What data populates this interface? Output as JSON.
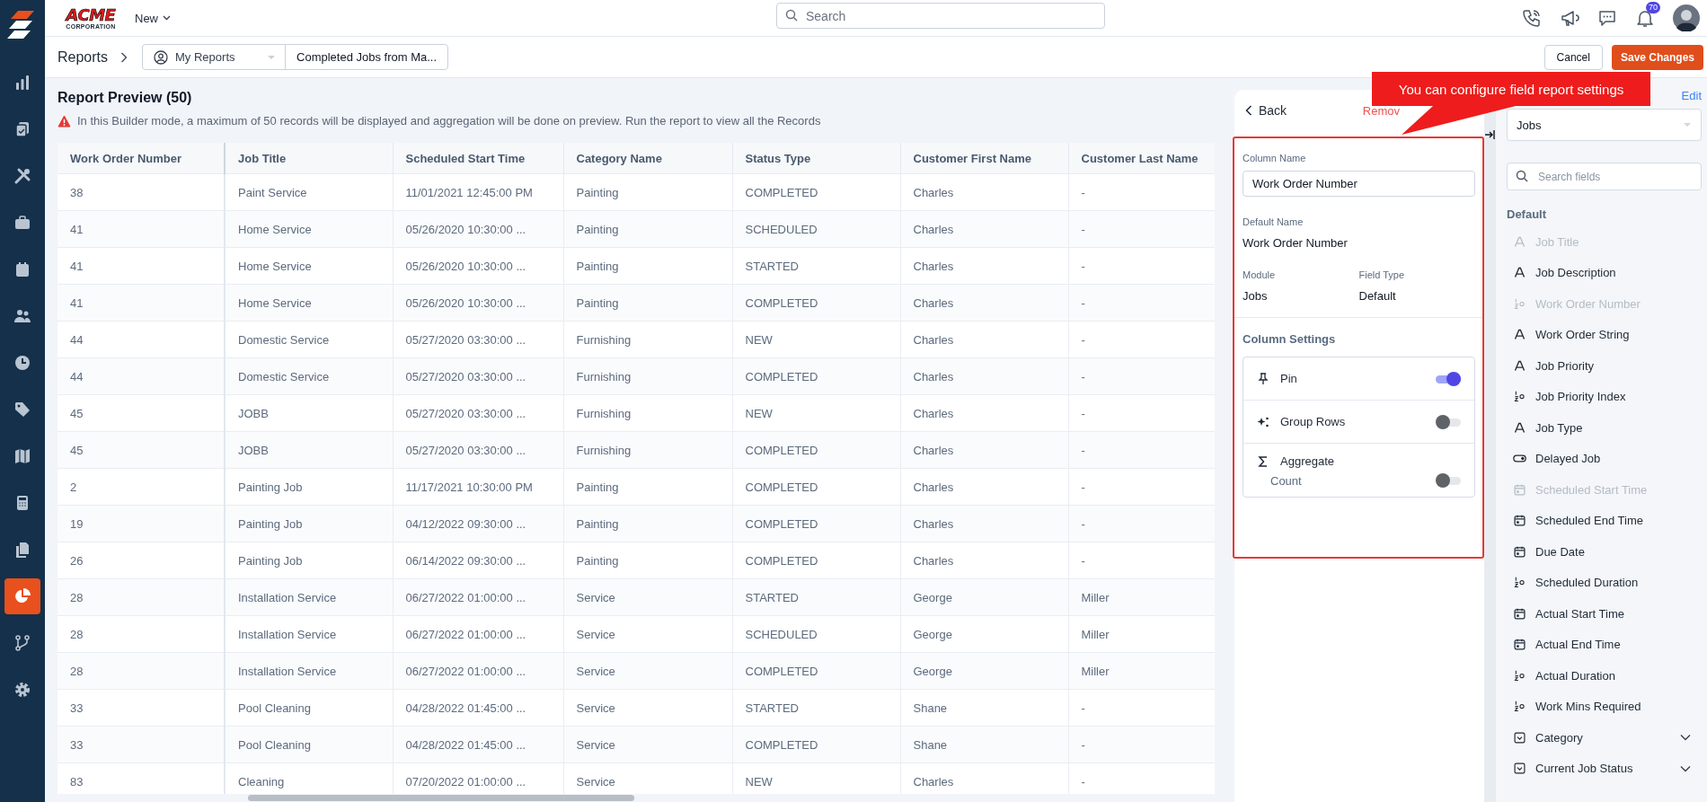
{
  "logo": {
    "name": "ACME",
    "subtitle": "CORPORATION"
  },
  "new_menu": {
    "label": "New"
  },
  "search": {
    "placeholder": "Search"
  },
  "notifications": {
    "count": "70"
  },
  "sidebar": {
    "items": [
      {
        "selected": false
      },
      {
        "selected": false
      },
      {
        "selected": false
      },
      {
        "selected": false
      },
      {
        "selected": false
      },
      {
        "selected": false
      },
      {
        "selected": false
      },
      {
        "selected": false
      },
      {
        "selected": false
      },
      {
        "selected": false
      },
      {
        "selected": false
      },
      {
        "selected": true
      },
      {
        "selected": false
      },
      {
        "selected": false
      }
    ]
  },
  "breadcrumb": {
    "root": "Reports",
    "folder": "My Reports",
    "report": "Completed Jobs from Ma..."
  },
  "buttons": {
    "cancel": "Cancel",
    "save": "Save Changes"
  },
  "preview": {
    "title": "Report Preview (50)",
    "warning": "In this Builder mode, a maximum of 50 records will be displayed and aggregation will be done on preview. Run the report to view all the Records"
  },
  "table": {
    "columns": [
      "Work Order Number",
      "Job Title",
      "Scheduled Start Time",
      "Category Name",
      "Status Type",
      "Customer First Name",
      "Customer Last Name"
    ],
    "rows": [
      [
        "38",
        "Paint Service",
        "11/01/2021 12:45:00 PM",
        "Painting",
        "COMPLETED",
        "Charles",
        "-"
      ],
      [
        "41",
        "Home Service",
        "05/26/2020 10:30:00 ...",
        "Painting",
        "SCHEDULED",
        "Charles",
        "-"
      ],
      [
        "41",
        "Home Service",
        "05/26/2020 10:30:00 ...",
        "Painting",
        "STARTED",
        "Charles",
        "-"
      ],
      [
        "41",
        "Home Service",
        "05/26/2020 10:30:00 ...",
        "Painting",
        "COMPLETED",
        "Charles",
        "-"
      ],
      [
        "44",
        "Domestic Service",
        "05/27/2020 03:30:00 ...",
        "Furnishing",
        "NEW",
        "Charles",
        "-"
      ],
      [
        "44",
        "Domestic Service",
        "05/27/2020 03:30:00 ...",
        "Furnishing",
        "COMPLETED",
        "Charles",
        "-"
      ],
      [
        "45",
        "JOBB",
        "05/27/2020 03:30:00 ...",
        "Furnishing",
        "NEW",
        "Charles",
        "-"
      ],
      [
        "45",
        "JOBB",
        "05/27/2020 03:30:00 ...",
        "Furnishing",
        "COMPLETED",
        "Charles",
        "-"
      ],
      [
        "2",
        "Painting Job",
        "11/17/2021 10:30:00 PM",
        "Painting",
        "COMPLETED",
        "Charles",
        "-"
      ],
      [
        "19",
        "Painting Job",
        "04/12/2022 09:30:00 ...",
        "Painting",
        "COMPLETED",
        "Charles",
        "-"
      ],
      [
        "26",
        "Painting Job",
        "06/14/2022 09:30:00 ...",
        "Painting",
        "COMPLETED",
        "Charles",
        "-"
      ],
      [
        "28",
        "Installation Service",
        "06/27/2022 01:00:00 ...",
        "Service",
        "STARTED",
        "George",
        "Miller"
      ],
      [
        "28",
        "Installation Service",
        "06/27/2022 01:00:00 ...",
        "Service",
        "SCHEDULED",
        "George",
        "Miller"
      ],
      [
        "28",
        "Installation Service",
        "06/27/2022 01:00:00 ...",
        "Service",
        "COMPLETED",
        "George",
        "Miller"
      ],
      [
        "33",
        "Pool Cleaning",
        "04/28/2022 01:45:00 ...",
        "Service",
        "STARTED",
        "Shane",
        "-"
      ],
      [
        "33",
        "Pool Cleaning",
        "04/28/2022 01:45:00 ...",
        "Service",
        "COMPLETED",
        "Shane",
        "-"
      ],
      [
        "83",
        "Cleaning",
        "07/20/2022 01:00:00 ...",
        "Service",
        "NEW",
        "Charles",
        "-"
      ]
    ]
  },
  "tooltip": {
    "text": "You can configure field report settings"
  },
  "column_panel": {
    "back": "Back",
    "remove": "Remov",
    "column_name_label": "Column Name",
    "column_name": "Work Order Number",
    "default_name_label": "Default Name",
    "default_name": "Work Order Number",
    "module_label": "Module",
    "module": "Jobs",
    "field_type_label": "Field Type",
    "field_type": "Default",
    "settings_title": "Column Settings",
    "settings": [
      {
        "kind": "pin",
        "label": "Pin",
        "on": true
      },
      {
        "kind": "group",
        "label": "Group Rows",
        "on": false
      },
      {
        "kind": "aggregate",
        "label": "Aggregate",
        "sub_label": "Count",
        "on": false
      }
    ]
  },
  "fields_panel": {
    "edit": "Edit",
    "module": "Jobs",
    "search_placeholder": "Search fields",
    "group": "Default",
    "items": [
      {
        "kind": "text",
        "label": "Job Title",
        "disabled": true
      },
      {
        "kind": "text",
        "label": "Job Description",
        "disabled": false
      },
      {
        "kind": "number",
        "label": "Work Order Number",
        "disabled": true
      },
      {
        "kind": "text",
        "label": "Work Order String",
        "disabled": false
      },
      {
        "kind": "text",
        "label": "Job Priority",
        "disabled": false
      },
      {
        "kind": "number",
        "label": "Job Priority Index",
        "disabled": false
      },
      {
        "kind": "text",
        "label": "Job Type",
        "disabled": false
      },
      {
        "kind": "toggle",
        "label": "Delayed Job",
        "disabled": false
      },
      {
        "kind": "date",
        "label": "Scheduled Start Time",
        "disabled": true
      },
      {
        "kind": "date",
        "label": "Scheduled End Time",
        "disabled": false
      },
      {
        "kind": "date",
        "label": "Due Date",
        "disabled": false
      },
      {
        "kind": "number",
        "label": "Scheduled Duration",
        "disabled": false
      },
      {
        "kind": "date",
        "label": "Actual Start Time",
        "disabled": false
      },
      {
        "kind": "date",
        "label": "Actual End Time",
        "disabled": false
      },
      {
        "kind": "number",
        "label": "Actual Duration",
        "disabled": false
      },
      {
        "kind": "number",
        "label": "Work Mins Required",
        "disabled": false
      },
      {
        "kind": "dropdown",
        "label": "Category",
        "disabled": false
      },
      {
        "kind": "dropdown",
        "label": "Current Job Status",
        "disabled": false
      }
    ]
  }
}
